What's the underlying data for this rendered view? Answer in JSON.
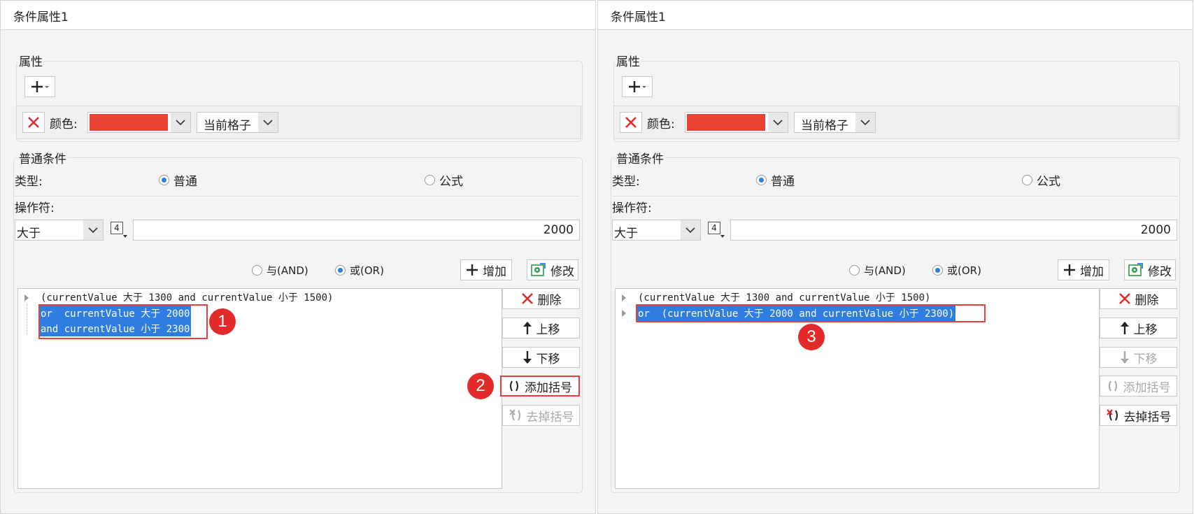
{
  "panels": [
    {
      "title": "条件属性1",
      "attr_group": "属性",
      "color_label": "颜色:",
      "color_value": "#ea4335",
      "scope": "当前格子",
      "cond_group": "普通条件",
      "type_label": "类型:",
      "type_normal": "普通",
      "type_formula": "公式",
      "op_label": "操作符:",
      "op_value": "大于",
      "param_value": "2000",
      "param_icon_text": "4",
      "and_label": "与(AND)",
      "or_label": "或(OR)",
      "add_btn": "增加",
      "modify_btn": "修改",
      "conditions": [
        {
          "text": "(currentValue 大于 1300 and currentValue 小于 1500)",
          "selected": false
        },
        {
          "text": "or  currentValue 大于 2000",
          "selected": true
        },
        {
          "text": "and currentValue 小于 2300",
          "selected": true
        }
      ],
      "delete_btn": "删除",
      "up_btn": "上移",
      "down_btn": "下移",
      "add_paren_btn": "添加括号",
      "remove_paren_btn": "去掉括号",
      "badges": [
        "1",
        "2"
      ]
    },
    {
      "title": "条件属性1",
      "attr_group": "属性",
      "color_label": "颜色:",
      "color_value": "#ea4335",
      "scope": "当前格子",
      "cond_group": "普通条件",
      "type_label": "类型:",
      "type_normal": "普通",
      "type_formula": "公式",
      "op_label": "操作符:",
      "op_value": "大于",
      "param_value": "2000",
      "param_icon_text": "4",
      "and_label": "与(AND)",
      "or_label": "或(OR)",
      "add_btn": "增加",
      "modify_btn": "修改",
      "conditions": [
        {
          "text": "(currentValue 大于 1300 and currentValue 小于 1500)",
          "selected": false
        },
        {
          "text": "or  (currentValue 大于 2000 and currentValue 小于 2300)",
          "selected": true
        }
      ],
      "delete_btn": "删除",
      "up_btn": "上移",
      "down_btn": "下移",
      "add_paren_btn": "添加括号",
      "remove_paren_btn": "去掉括号",
      "badges": [
        "3"
      ]
    }
  ],
  "colors": {
    "selection": "#2f7de1",
    "annotation": "#e32b2b",
    "swatch": "#ea4335"
  }
}
